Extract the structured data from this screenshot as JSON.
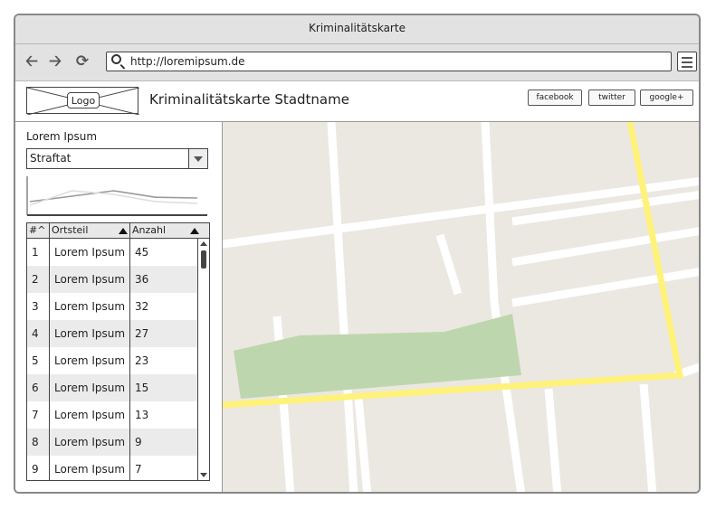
{
  "window": {
    "title": "Kriminalitätskarte"
  },
  "nav": {
    "back_icon": "arrow-left-icon",
    "forward_icon": "arrow-right-icon",
    "reload_icon": "reload-icon",
    "url": "http://loremipsum.de",
    "menu_icon": "hamburger-icon"
  },
  "header": {
    "logo_label": "Logo",
    "title": "Kriminalitätskarte Stadtname",
    "social": [
      "facebook",
      "twitter",
      "google+"
    ]
  },
  "sidebar": {
    "title": "Lorem Ipsum",
    "select_value": "Straftat",
    "sparkline": {
      "series": [
        {
          "values": [
            30,
            45,
            60,
            42,
            40
          ],
          "color": "#999999"
        },
        {
          "values": [
            20,
            60,
            50,
            30,
            25
          ],
          "color": "#dddddd"
        }
      ]
    },
    "table": {
      "columns": [
        "#^",
        "Ortsteil",
        "Anzahl"
      ],
      "rows": [
        {
          "num": "1",
          "ortsteil": "Lorem Ipsum",
          "anzahl": "45"
        },
        {
          "num": "2",
          "ortsteil": "Lorem Ipsum",
          "anzahl": "36"
        },
        {
          "num": "3",
          "ortsteil": "Lorem Ipsum",
          "anzahl": "32"
        },
        {
          "num": "4",
          "ortsteil": "Lorem Ipsum",
          "anzahl": "27"
        },
        {
          "num": "5",
          "ortsteil": "Lorem Ipsum",
          "anzahl": "23"
        },
        {
          "num": "6",
          "ortsteil": "Lorem Ipsum",
          "anzahl": "15"
        },
        {
          "num": "7",
          "ortsteil": "Lorem Ipsum",
          "anzahl": "13"
        },
        {
          "num": "8",
          "ortsteil": "Lorem Ipsum",
          "anzahl": "9"
        },
        {
          "num": "9",
          "ortsteil": "Lorem Ipsum",
          "anzahl": "7"
        }
      ]
    }
  },
  "map": {
    "colors": {
      "ground": "#ebe8e1",
      "street": "#ffffff",
      "highway": "#fff27a",
      "park": "#bed6ae"
    }
  }
}
